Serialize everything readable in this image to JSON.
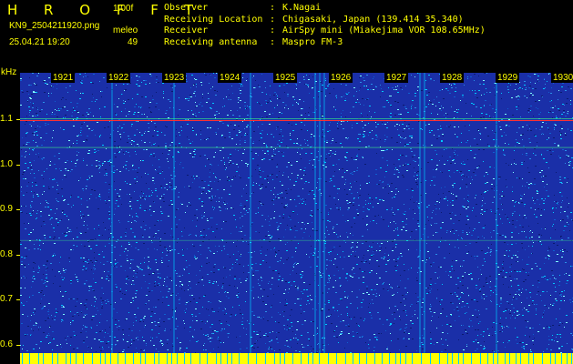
{
  "header": {
    "title": "H R O F F T",
    "version": "1.00f",
    "filename": "KN9_2504211920.png",
    "meleo_label": "meleo",
    "datetime": "25.04.21 19:20",
    "count": "49"
  },
  "info": {
    "rows": [
      {
        "key": "Observer",
        "value": "K.Nagai"
      },
      {
        "key": "Receiving Location",
        "value": "Chigasaki, Japan (139.414 35.340)"
      },
      {
        "key": "Receiver",
        "value": "AirSpy mini (Miakejima VOR 108.65MHz)"
      },
      {
        "key": "Receiving antenna",
        "value": "Maspro FM-3"
      }
    ]
  },
  "spectrogram": {
    "y_unit": "kHz",
    "y_ticks": [
      "1.1",
      "1.0",
      "0.9",
      "0.8",
      "0.7",
      "0.6"
    ],
    "x_ticks": [
      "1921",
      "1922",
      "1923",
      "1924",
      "1925",
      "1926",
      "1927",
      "1928",
      "1929",
      "1930"
    ],
    "colors": {
      "background": "#1a2fa8",
      "noise_low": "#0a1a6e",
      "noise_mid": "#00c8ff",
      "noise_high": "#80ffff",
      "line_red": "#ff3030",
      "line_green": "#40ff80",
      "baseline": "#ffff00"
    }
  }
}
